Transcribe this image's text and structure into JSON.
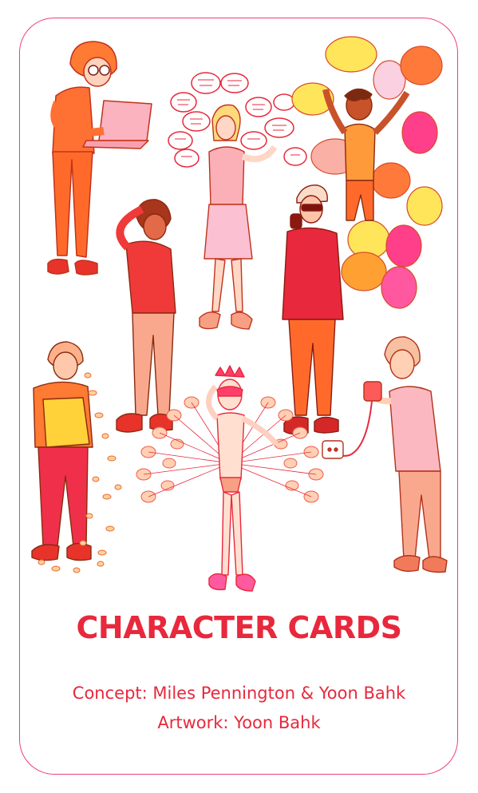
{
  "card": {
    "title": "CHARACTER CARDS",
    "concept_line": "Concept: Miles Pennington & Yoon Bahk",
    "artwork_line": "Artwork: Yoon Bahk"
  },
  "colors": {
    "border": "#ee3f7a",
    "title": "#e8283c",
    "orange": "#ff6a2a",
    "red": "#f03a3a",
    "pink": "#f9a3b5",
    "yellow": "#ffe03a",
    "magenta": "#ff3f8a",
    "skin": "#ffd7c4"
  },
  "illustration": {
    "characters": [
      "laptop-person",
      "talking-woman-with-speech-bubbles",
      "boy-with-balloons",
      "thinking-man",
      "phone-man-with-sunglasses",
      "chips-eating-kid",
      "peacock-dancer",
      "old-man-with-plug"
    ]
  }
}
